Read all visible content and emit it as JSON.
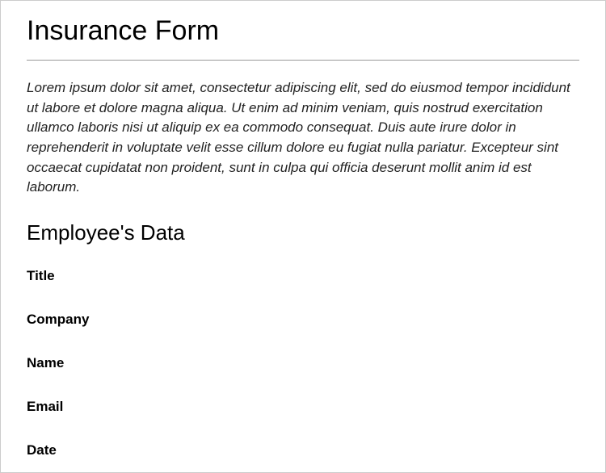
{
  "page": {
    "title": "Insurance Form",
    "intro": "Lorem ipsum dolor sit amet, consectetur adipiscing elit, sed do eiusmod tempor incididunt ut labore et dolore magna aliqua. Ut enim ad minim veniam, quis nostrud exercitation ullamco laboris nisi ut aliquip ex ea commodo consequat. Duis aute irure dolor in reprehenderit in voluptate velit esse cillum dolore eu fugiat nulla pariatur. Excepteur sint occaecat cupidatat non proident, sunt in culpa qui officia deserunt mollit anim id est laborum."
  },
  "section": {
    "title": "Employee's Data",
    "fields": [
      {
        "label": "Title"
      },
      {
        "label": "Company"
      },
      {
        "label": "Name"
      },
      {
        "label": "Email"
      },
      {
        "label": "Date"
      }
    ]
  }
}
